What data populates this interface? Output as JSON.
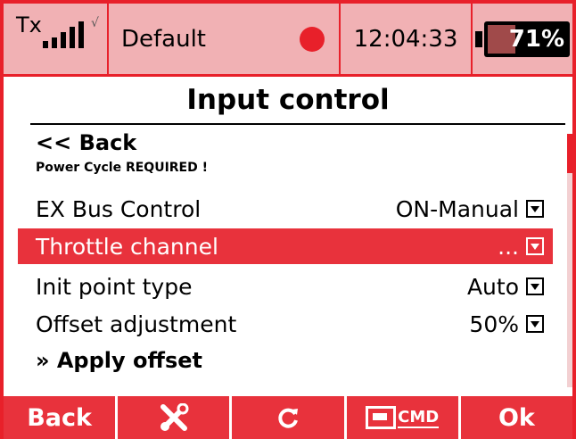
{
  "status": {
    "tx_label": "Tx",
    "profile_name": "Default",
    "time": "12:04:33",
    "battery_percent_label": "71%",
    "battery_fraction": 0.71,
    "signal_bars": 5
  },
  "screen": {
    "title": "Input control"
  },
  "menu": {
    "back_label": "<< Back",
    "notice": "Power Cycle REQUIRED !",
    "rows": [
      {
        "label": "EX Bus Control",
        "value": "ON-Manual"
      },
      {
        "label": "Throttle channel",
        "value": "..."
      },
      {
        "label": "Init point type",
        "value": "Auto"
      },
      {
        "label": "Offset adjustment",
        "value": "50%"
      }
    ],
    "apply_label": "» Apply offset"
  },
  "footer": {
    "back": "Back",
    "tools_icon": "tools-icon",
    "refresh_icon": "refresh-icon",
    "cmd_label": "CMD",
    "ok": "Ok"
  },
  "colors": {
    "accent": "#e8202a",
    "status_bg": "#f1b1b4",
    "selected_row": "#e8323c"
  }
}
